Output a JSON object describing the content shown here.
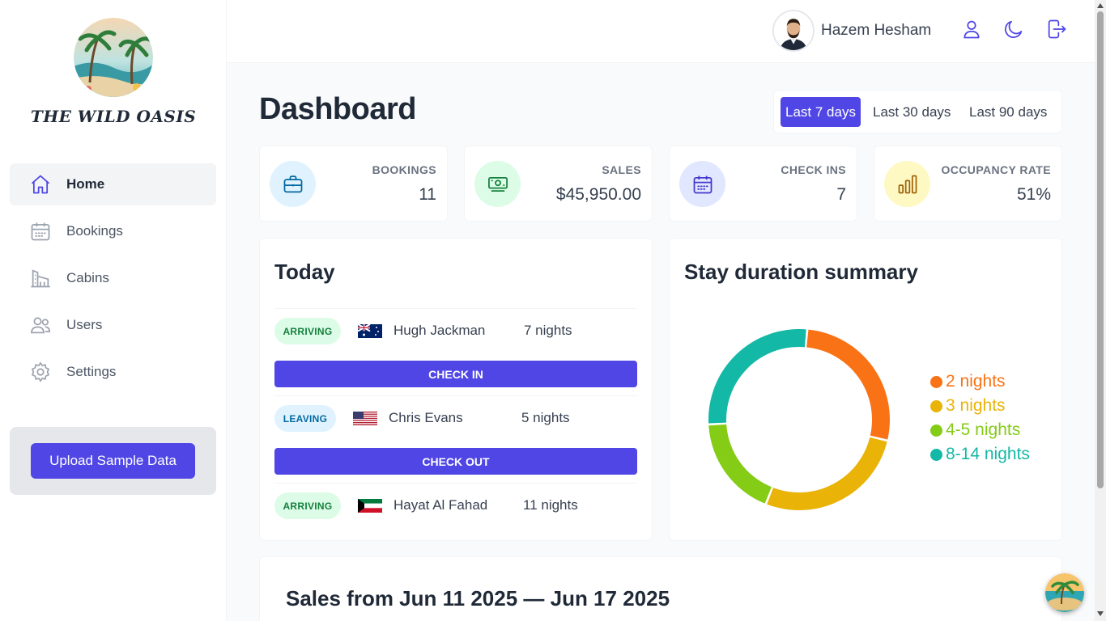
{
  "app": {
    "logo_text": "THE WILD OASIS"
  },
  "sidebar": {
    "items": [
      {
        "label": "Home",
        "icon": "home-icon",
        "active": true
      },
      {
        "label": "Bookings",
        "icon": "calendar-icon"
      },
      {
        "label": "Cabins",
        "icon": "cabins-icon"
      },
      {
        "label": "Users",
        "icon": "users-icon"
      },
      {
        "label": "Settings",
        "icon": "gear-icon"
      }
    ],
    "upload_label": "Upload Sample Data"
  },
  "header": {
    "user_name": "Hazem Hesham",
    "icons": [
      "user-icon",
      "moon-icon",
      "logout-icon"
    ]
  },
  "main": {
    "title": "Dashboard",
    "filters": [
      "Last 7 days",
      "Last 30 days",
      "Last 90 days"
    ],
    "active_filter": "Last 7 days",
    "stats": [
      {
        "label": "Bookings",
        "value": "11",
        "icon": "briefcase-icon",
        "color": "#0369a1",
        "bg": "#e0f2fe"
      },
      {
        "label": "Sales",
        "value": "$45,950.00",
        "icon": "banknotes-icon",
        "color": "#15803d",
        "bg": "#dcfce7"
      },
      {
        "label": "Check ins",
        "value": "7",
        "icon": "calendar-icon",
        "color": "#4338ca",
        "bg": "#e0e7ff"
      },
      {
        "label": "Occupancy rate",
        "value": "51%",
        "icon": "chart-bar-icon",
        "color": "#a16207",
        "bg": "#fef9c3"
      }
    ],
    "today": {
      "title": "Today",
      "rows": [
        {
          "status": "ARRIVING",
          "flag": "australia-flag",
          "guest": "Hugh Jackman",
          "nights": "7 nights",
          "action": "CHECK IN"
        },
        {
          "status": "LEAVING",
          "flag": "usa-flag",
          "guest": "Chris Evans",
          "nights": "5 nights",
          "action": "CHECK OUT"
        },
        {
          "status": "ARRIVING",
          "flag": "kuwait-flag",
          "guest": "Hayat Al Fahad",
          "nights": "11 nights",
          "action": ""
        }
      ]
    },
    "stay_summary": {
      "title": "Stay duration summary"
    },
    "sales": {
      "title": "Sales from Jun 11 2025 — Jun 17 2025"
    }
  },
  "chart_data": {
    "type": "pie",
    "title": "Stay duration summary",
    "categories": [
      "2 nights",
      "3 nights",
      "4-5 nights",
      "8-14 nights"
    ],
    "values": [
      3,
      3,
      2,
      3
    ],
    "colors": [
      "#f97316",
      "#eab308",
      "#84cc16",
      "#14b8a6"
    ],
    "legend": "right"
  }
}
